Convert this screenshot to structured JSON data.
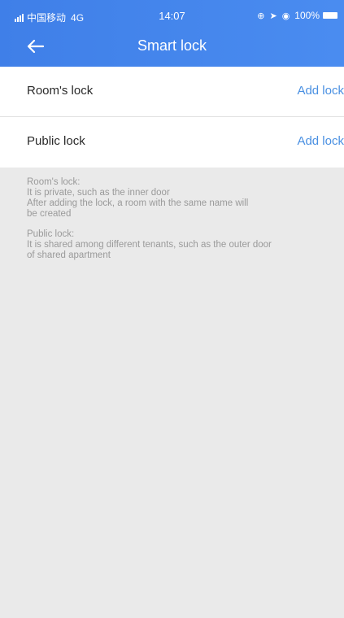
{
  "status_bar": {
    "carrier": "中国移动",
    "network": "4G",
    "time": "14:07",
    "battery": "100%"
  },
  "nav": {
    "title": "Smart lock"
  },
  "rows": [
    {
      "label": "Room's lock",
      "action": "Add lock"
    },
    {
      "label": "Public lock",
      "action": "Add lock"
    }
  ],
  "info": {
    "room_title": "Room's lock:",
    "room_line1": "It is private, such as the inner door",
    "room_line2": "After adding the lock, a room with the same name will",
    "room_line3": "be created",
    "public_title": "Public lock:",
    "public_line1": "It is shared among different tenants, such as the outer door",
    "public_line2": "of shared apartment"
  },
  "colors": {
    "header": "#4a8cf0",
    "action": "#4a90e2",
    "background": "#eaeaea"
  }
}
